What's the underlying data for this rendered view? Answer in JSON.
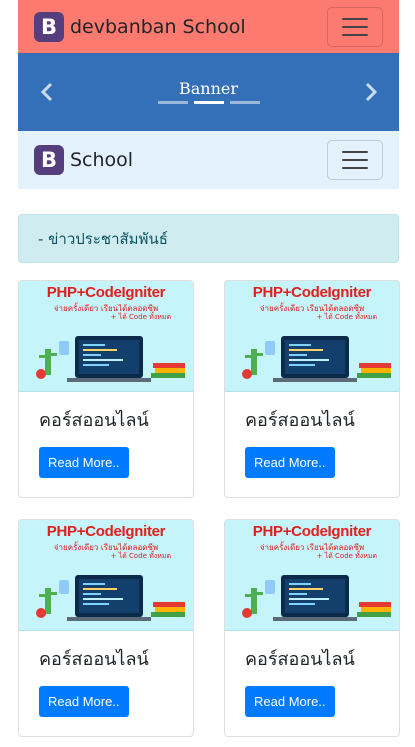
{
  "navbar": {
    "logo_letter": "B",
    "brand": "devbanban School"
  },
  "carousel": {
    "caption": "Banner",
    "prev_icon": "chevron-left-icon",
    "next_icon": "chevron-right-icon",
    "slide_count": 3,
    "active_slide": 1
  },
  "subnav": {
    "logo_letter": "B",
    "brand": "School"
  },
  "alert": {
    "text": "- ข่าวประชาสัมพันธ์"
  },
  "cards": [
    {
      "image_title": "PHP+CodeIgniter",
      "image_line1": "จ่ายครั้งเดียว เรียนได้ตลอดชีพ",
      "image_line2": "+ ได้ Code ทั้งหมด",
      "title": "คอร์สออนไลน์",
      "button": "Read More.."
    },
    {
      "image_title": "PHP+CodeIgniter",
      "image_line1": "จ่ายครั้งเดียว เรียนได้ตลอดชีพ",
      "image_line2": "+ ได้ Code ทั้งหมด",
      "title": "คอร์สออนไลน์",
      "button": "Read More.."
    },
    {
      "image_title": "PHP+CodeIgniter",
      "image_line1": "จ่ายครั้งเดียว เรียนได้ตลอดชีพ",
      "image_line2": "+ ได้ Code ทั้งหมด",
      "title": "คอร์สออนไลน์",
      "button": "Read More.."
    },
    {
      "image_title": "PHP+CodeIgniter",
      "image_line1": "จ่ายครั้งเดียว เรียนได้ตลอดชีพ",
      "image_line2": "+ ได้ Code ทั้งหมด",
      "title": "คอร์สออนไลน์",
      "button": "Read More.."
    }
  ],
  "colors": {
    "navbar_bg": "#fc7a6f",
    "banner_bg": "#3370b8",
    "subnav_bg": "#e3f2fd",
    "alert_bg": "#d1ecf1",
    "button_bg": "#007bff",
    "image_bg": "#c6f4fb"
  }
}
